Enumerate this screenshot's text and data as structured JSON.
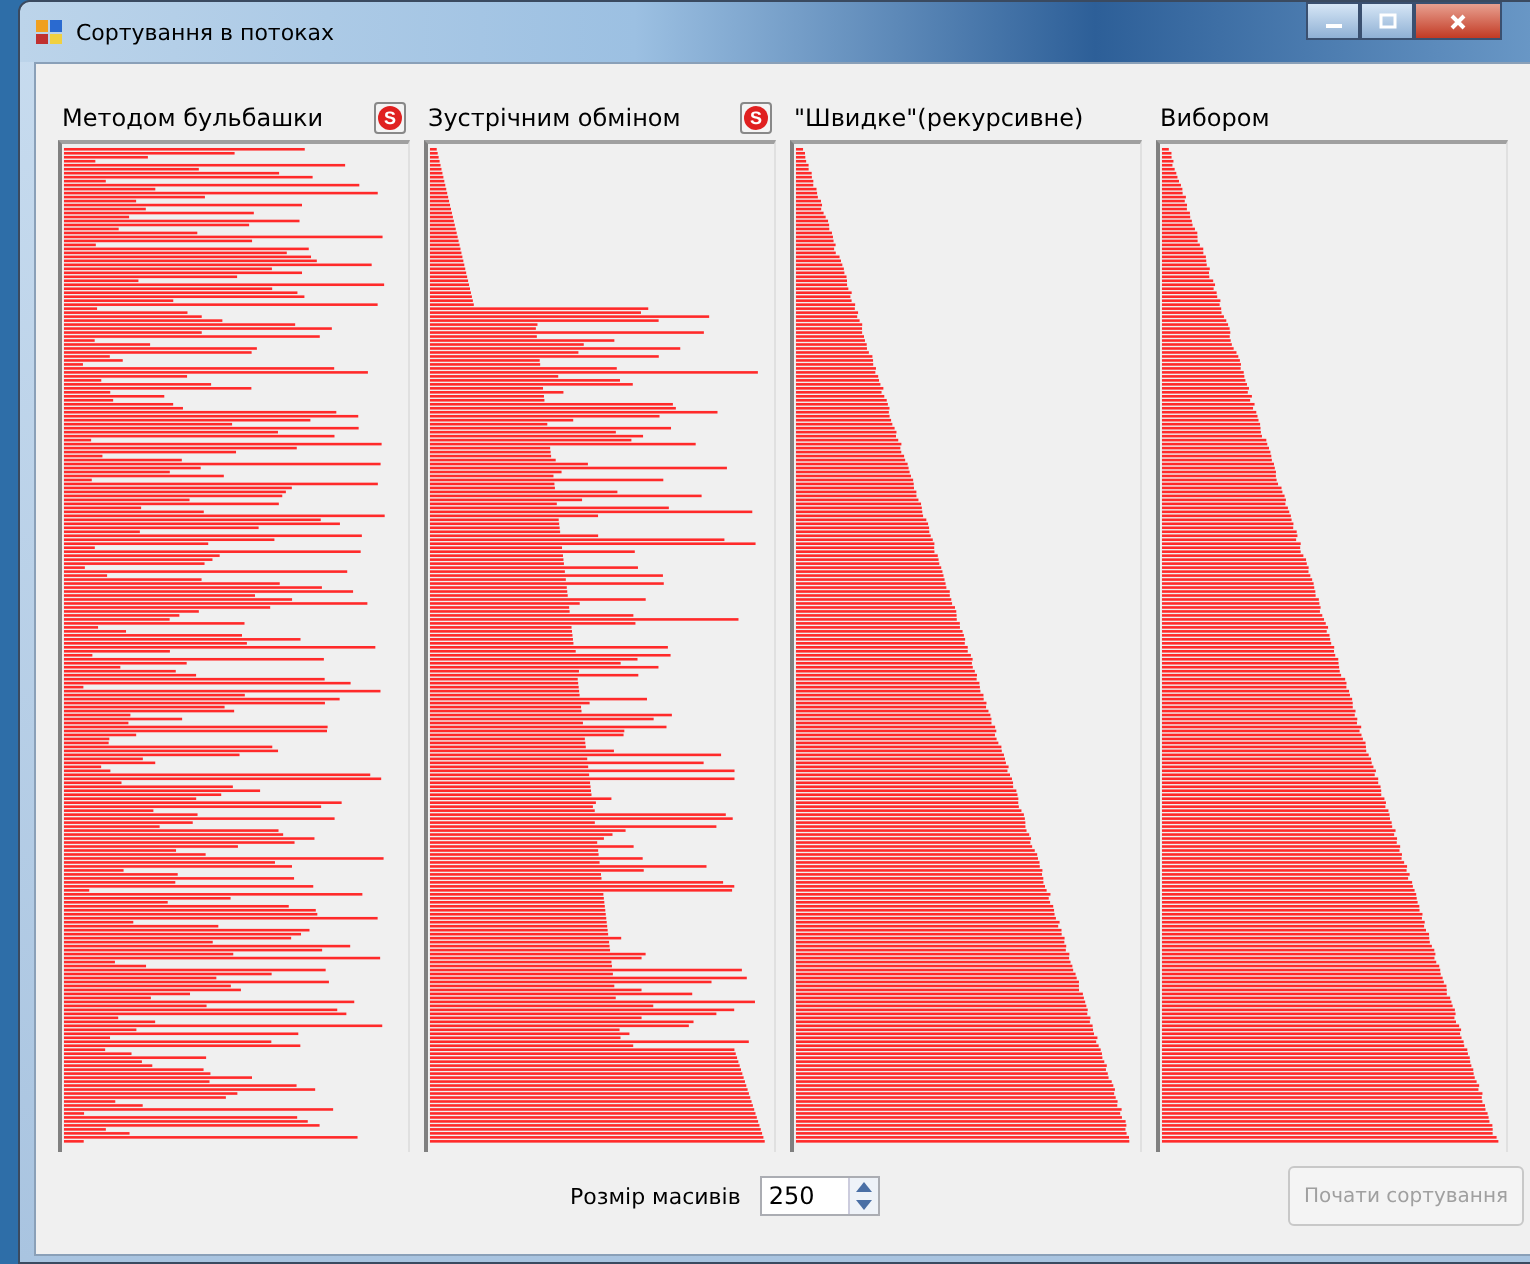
{
  "window": {
    "title": "Сортування в потоках"
  },
  "panels": [
    {
      "title": "Методом бульбашки",
      "stop_button": "S",
      "kind": "random"
    },
    {
      "title": "Зустрічним обміном",
      "stop_button": "S",
      "kind": "partial"
    },
    {
      "title": "\"Швидке\"(рекурсивне)",
      "kind": "sorted"
    },
    {
      "title": "Вибором",
      "kind": "sorted"
    }
  ],
  "size": {
    "label": "Розмір масивів",
    "value": "250"
  },
  "start_button": {
    "label": "Почати сортування",
    "disabled": true
  }
}
